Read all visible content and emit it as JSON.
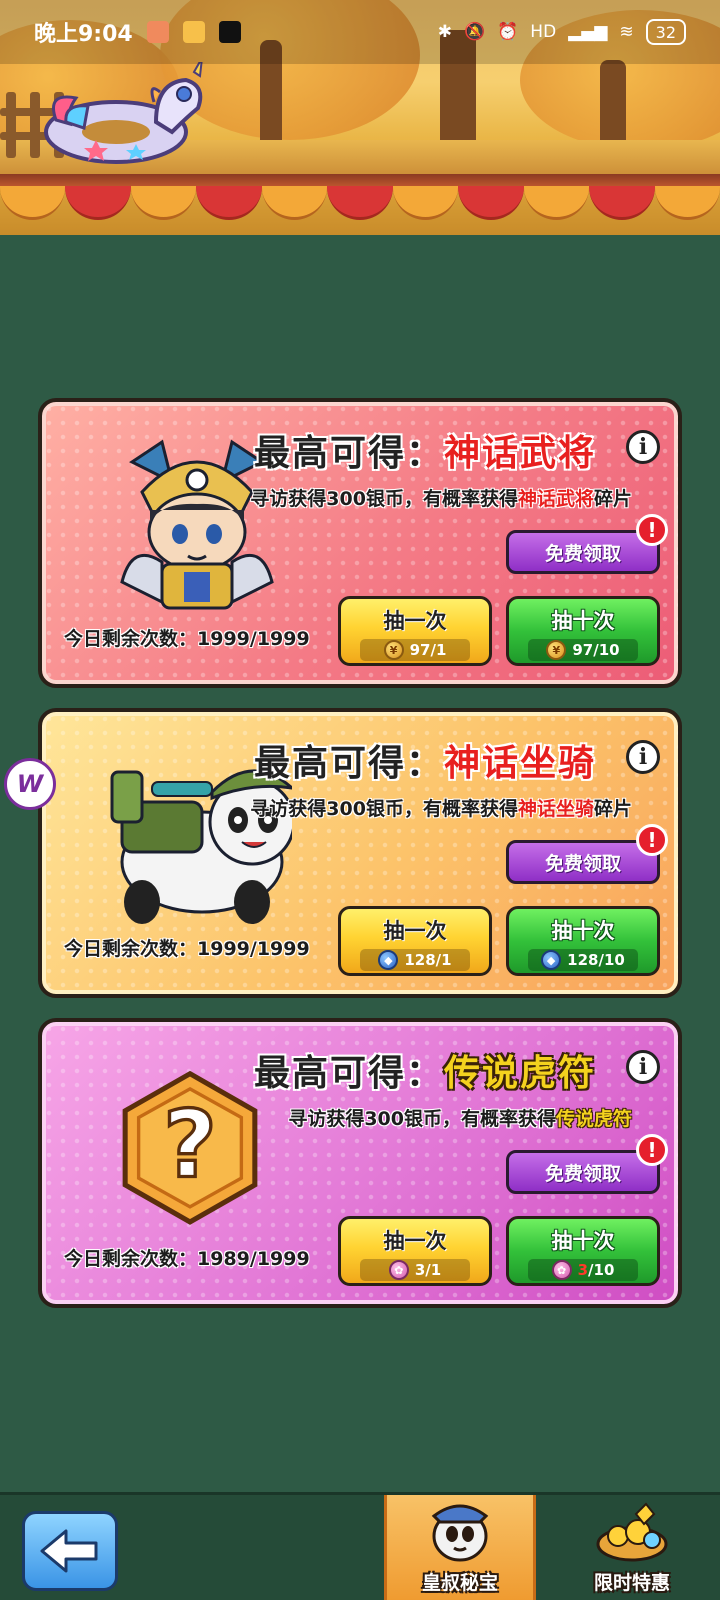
{
  "status_bar": {
    "time": "晚上9:04",
    "network": "HD",
    "battery": "32"
  },
  "cards": [
    {
      "title_prefix": "最高可得：",
      "title_highlight": "神话武将",
      "desc_prefix": "寻访获得300银币，有概率获得",
      "desc_highlight": "神话武将",
      "desc_suffix": "碎片",
      "free_label": "免费领取",
      "alert": "!",
      "once_label": "抽一次",
      "once_cost": "97/1",
      "ten_label": "抽十次",
      "ten_cost_have": "97",
      "ten_cost_need": "/10",
      "remain_label": "今日剩余次数：",
      "remain_value": "1999/1999",
      "info_icon": "i"
    },
    {
      "title_prefix": "最高可得：",
      "title_highlight": "神话坐骑",
      "desc_prefix": "寻访获得300银币，有概率获得",
      "desc_highlight": "神话坐骑",
      "desc_suffix": "碎片",
      "free_label": "免费领取",
      "alert": "!",
      "once_label": "抽一次",
      "once_cost": "128/1",
      "ten_label": "抽十次",
      "ten_cost_have": "128",
      "ten_cost_need": "/10",
      "remain_label": "今日剩余次数：",
      "remain_value": "1999/1999",
      "info_icon": "i"
    },
    {
      "title_prefix": "最高可得：",
      "title_highlight": "传说虎符",
      "desc_prefix": "寻访获得300银币，有概率获得",
      "desc_highlight": "传说虎符",
      "desc_suffix": "",
      "free_label": "免费领取",
      "alert": "!",
      "once_label": "抽一次",
      "once_cost": "3/1",
      "ten_label": "抽十次",
      "ten_cost_have": "3",
      "ten_cost_need": "/10",
      "remain_label": "今日剩余次数：",
      "remain_value": "1989/1999",
      "info_icon": "i",
      "mystery_symbol": "?"
    }
  ],
  "side_float": {
    "label": "W"
  },
  "bottom_nav": {
    "back_icon": "arrow-left-icon",
    "tabs": [
      {
        "label": "皇叔秘宝"
      },
      {
        "label": "限时特惠"
      }
    ]
  },
  "colors": {
    "background": "#2e5a45",
    "card1": "#f47b86",
    "card2": "#fcc36a",
    "card3": "#e278d6",
    "highlight_red": "#e8201f",
    "highlight_gold": "#f4d21e"
  }
}
